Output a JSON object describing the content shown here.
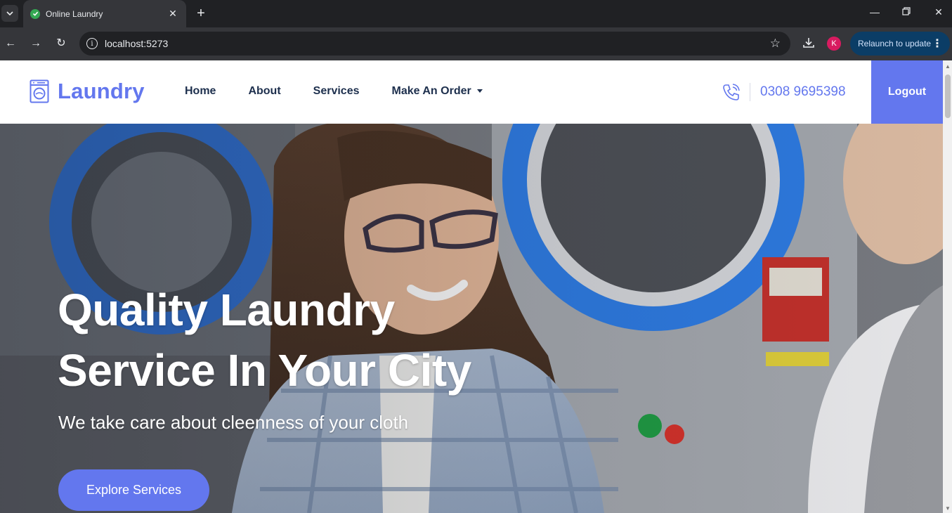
{
  "browser": {
    "tab_title": "Online Laundry",
    "url": "localhost:5273",
    "profile_initial": "K",
    "relaunch_label": "Relaunch to update"
  },
  "site": {
    "logo_text": "Laundry",
    "nav": [
      {
        "label": "Home"
      },
      {
        "label": "About"
      },
      {
        "label": "Services"
      },
      {
        "label": "Make An Order",
        "dropdown": true
      }
    ],
    "phone": "0308 9695398",
    "logout_label": "Logout"
  },
  "hero": {
    "title_line1": "Quality Laundry",
    "title_line2": "Service In Your City",
    "subtitle": "We take care about cleenness of your cloth",
    "cta_label": "Explore Services"
  },
  "colors": {
    "brand": "#6377ee",
    "nav_text": "#1d2f4d",
    "chrome_bg": "#202124",
    "chrome_toolbar": "#35363a"
  }
}
